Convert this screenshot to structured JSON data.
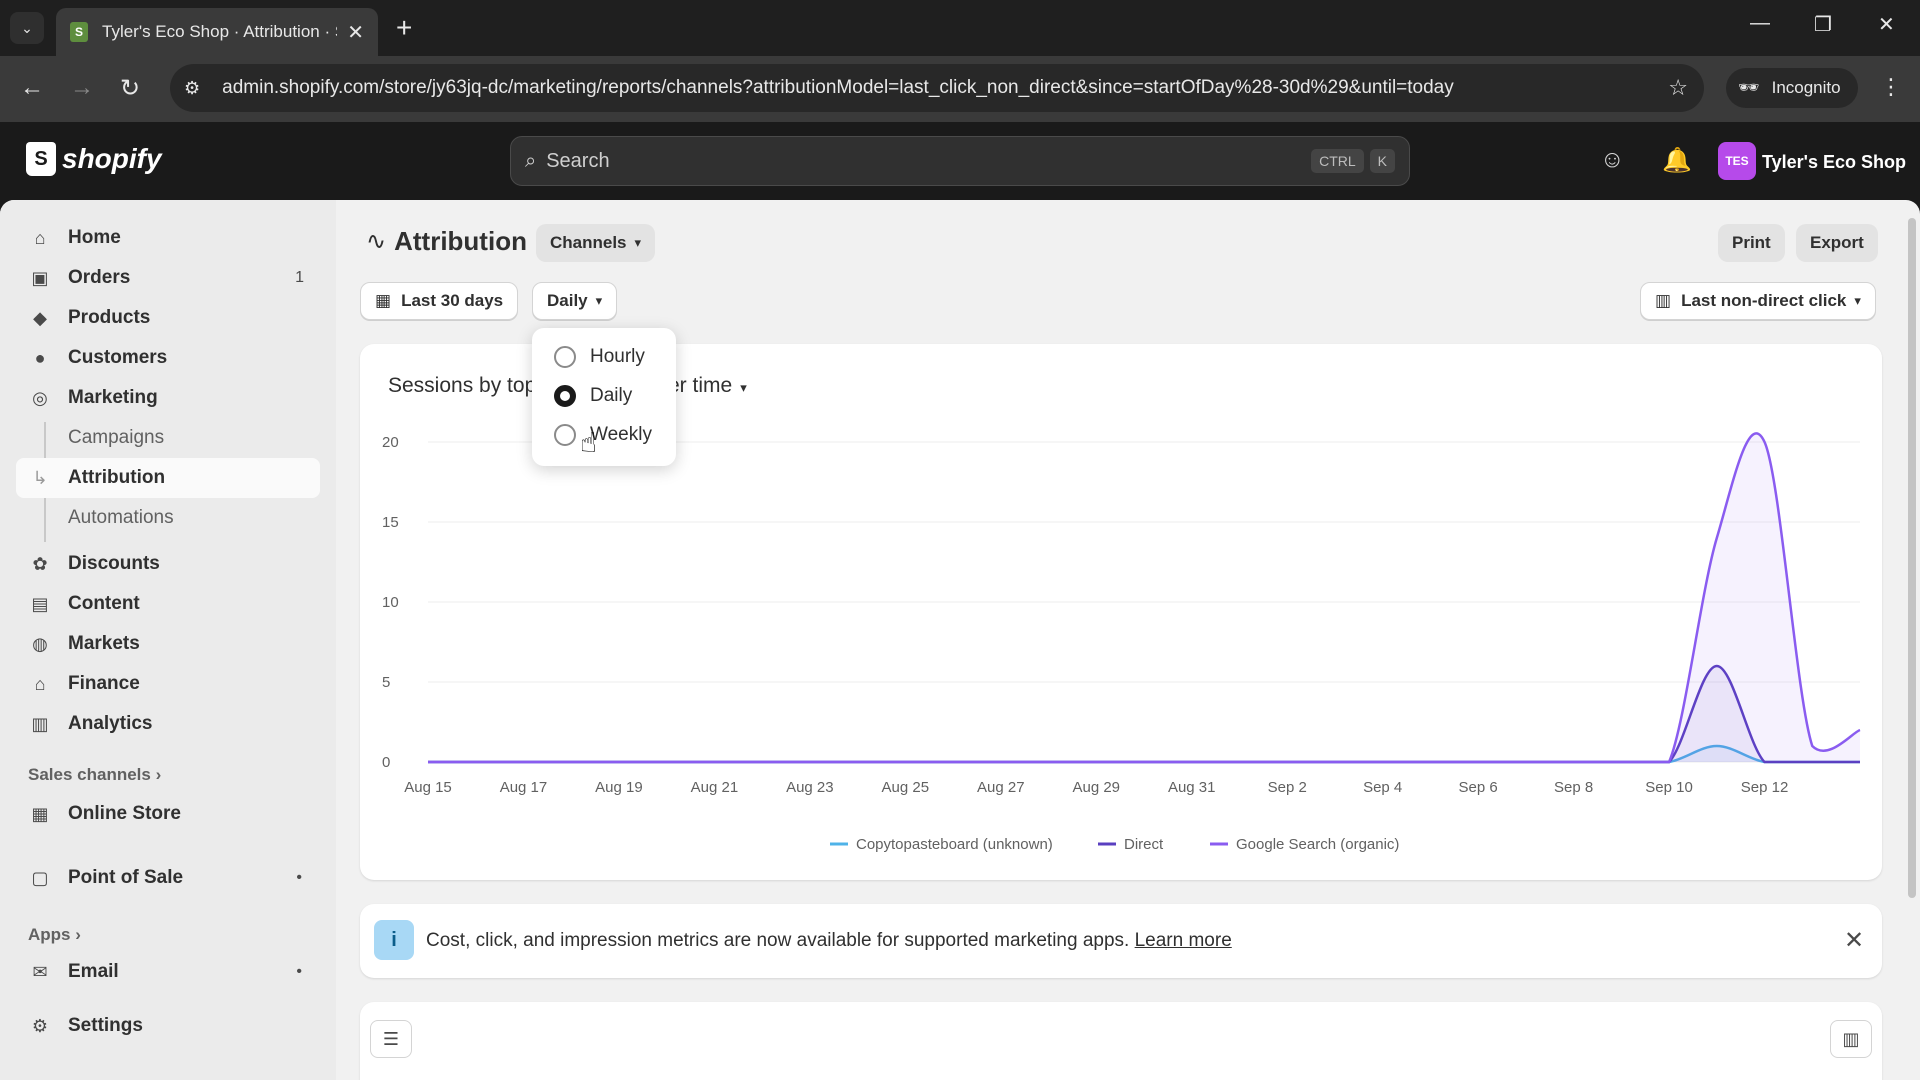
{
  "browser": {
    "tab_title": "Tyler's Eco Shop · Attribution · S",
    "url": "admin.shopify.com/store/jy63jq-dc/marketing/reports/channels?attributionModel=last_click_non_direct&since=startOfDay%28-30d%29&until=today",
    "incognito_label": "Incognito"
  },
  "topbar": {
    "brand": "shopify",
    "search_placeholder": "Search",
    "shortcut_key1": "CTRL",
    "shortcut_key2": "K",
    "store_initials": "TES",
    "store_name": "Tyler's Eco Shop"
  },
  "sidebar": {
    "items": [
      {
        "label": "Home",
        "icon": "home-icon"
      },
      {
        "label": "Orders",
        "icon": "orders-icon",
        "count": "1"
      },
      {
        "label": "Products",
        "icon": "tag-icon"
      },
      {
        "label": "Customers",
        "icon": "person-icon"
      },
      {
        "label": "Marketing",
        "icon": "target-icon"
      },
      {
        "label": "Campaigns"
      },
      {
        "label": "Attribution"
      },
      {
        "label": "Automations"
      },
      {
        "label": "Discounts",
        "icon": "discount-icon"
      },
      {
        "label": "Content",
        "icon": "content-icon"
      },
      {
        "label": "Markets",
        "icon": "globe-icon"
      },
      {
        "label": "Finance",
        "icon": "bank-icon"
      },
      {
        "label": "Analytics",
        "icon": "bar-chart-icon"
      }
    ],
    "sales_channels_label": "Sales channels",
    "online_store": "Online Store",
    "point_of_sale": "Point of Sale",
    "apps_label": "Apps",
    "email": "Email",
    "settings": "Settings"
  },
  "page": {
    "title": "Attribution",
    "channels_btn": "Channels",
    "print_btn": "Print",
    "export_btn": "Export",
    "date_range": "Last 30 days",
    "granularity": "Daily",
    "attribution_model": "Last non-direct click"
  },
  "granularity_menu": {
    "options": [
      "Hourly",
      "Daily",
      "Weekly"
    ],
    "selected": "Daily"
  },
  "chart_heading_left": "Sessions by top",
  "chart_heading_right": "er time",
  "chart_data": {
    "type": "line",
    "title": "",
    "xlabel": "",
    "ylabel": "",
    "ylim": [
      0,
      20
    ],
    "yticks": [
      0,
      5,
      10,
      15,
      20
    ],
    "x": [
      "Aug 15",
      "Aug 16",
      "Aug 17",
      "Aug 18",
      "Aug 19",
      "Aug 20",
      "Aug 21",
      "Aug 22",
      "Aug 23",
      "Aug 24",
      "Aug 25",
      "Aug 26",
      "Aug 27",
      "Aug 28",
      "Aug 29",
      "Aug 30",
      "Aug 31",
      "Sep 1",
      "Sep 2",
      "Sep 3",
      "Sep 4",
      "Sep 5",
      "Sep 6",
      "Sep 7",
      "Sep 8",
      "Sep 9",
      "Sep 10",
      "Sep 11",
      "Sep 12",
      "Sep 13",
      "Sep 14"
    ],
    "xticks": [
      "Aug 15",
      "Aug 17",
      "Aug 19",
      "Aug 21",
      "Aug 23",
      "Aug 25",
      "Aug 27",
      "Aug 29",
      "Aug 31",
      "Sep 2",
      "Sep 4",
      "Sep 6",
      "Sep 8",
      "Sep 10",
      "Sep 12"
    ],
    "series": [
      {
        "name": "Copytopasteboard (unknown)",
        "color": "#4fb3e8",
        "values": [
          0,
          0,
          0,
          0,
          0,
          0,
          0,
          0,
          0,
          0,
          0,
          0,
          0,
          0,
          0,
          0,
          0,
          0,
          0,
          0,
          0,
          0,
          0,
          0,
          0,
          0,
          0,
          1,
          0,
          0,
          0
        ]
      },
      {
        "name": "Direct",
        "color": "#5a3fc0",
        "values": [
          0,
          0,
          0,
          0,
          0,
          0,
          0,
          0,
          0,
          0,
          0,
          0,
          0,
          0,
          0,
          0,
          0,
          0,
          0,
          0,
          0,
          0,
          0,
          0,
          0,
          0,
          0,
          6,
          0,
          0,
          0
        ]
      },
      {
        "name": "Google Search (organic)",
        "color": "#8a5cf0",
        "values": [
          0,
          0,
          0,
          0,
          0,
          0,
          0,
          0,
          0,
          0,
          0,
          0,
          0,
          0,
          0,
          0,
          0,
          0,
          0,
          0,
          0,
          0,
          0,
          0,
          0,
          0,
          0,
          14,
          20,
          1,
          2
        ]
      }
    ],
    "legend_position": "bottom"
  },
  "info_banner": {
    "text": "Cost, click, and impression metrics are now available for supported marketing apps.",
    "link": "Learn more"
  }
}
